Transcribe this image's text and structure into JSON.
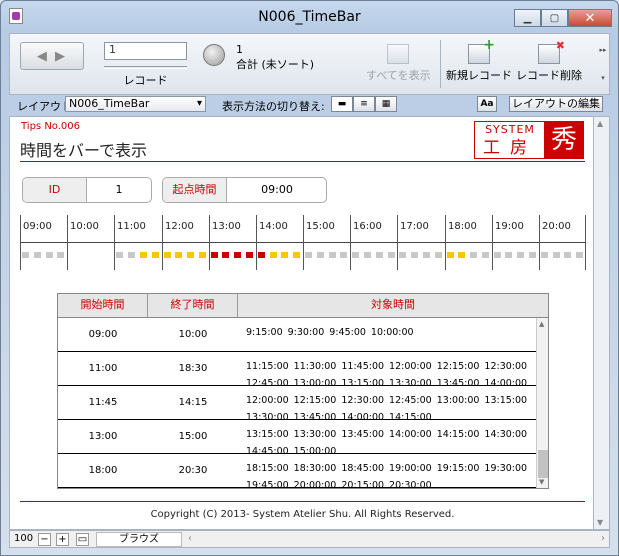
{
  "window": {
    "title": "N006_TimeBar"
  },
  "toolbar": {
    "record_value": "1",
    "record_label": "レコード",
    "found_count": "1",
    "found_label": "合計 (未ソート)",
    "show_all": "すべてを表示",
    "new_record": "新規レコード",
    "delete_record": "レコード削除"
  },
  "layoutbar": {
    "label": "レイアウト:",
    "layout": "N006_TimeBar",
    "view_as": "表示方法の切り替え:",
    "aa": "Aa",
    "edit_layout": "レイアウトの編集"
  },
  "page": {
    "tips": "Tips No.006",
    "heading": "時間をバーで表示",
    "logo": {
      "system": "SYSTEM",
      "kobo": "工房",
      "shu": "秀"
    },
    "id_label": "ID",
    "id_value": "1",
    "start_label": "起点時間",
    "start_value": "09:00"
  },
  "timeline": {
    "hours": [
      "09:00",
      "10:00",
      "11:00",
      "12:00",
      "13:00",
      "14:00",
      "15:00",
      "16:00",
      "17:00",
      "18:00",
      "19:00",
      "20:00"
    ],
    "segments_per_hour": 4,
    "slots": [
      "g",
      "g",
      "g",
      "g",
      "",
      "",
      "",
      "",
      "g",
      "g",
      "y",
      "y",
      "y",
      "y",
      "y",
      "y",
      "r",
      "r",
      "r",
      "r",
      "r",
      "y",
      "y",
      "y",
      "g",
      "g",
      "g",
      "g",
      "g",
      "g",
      "g",
      "g",
      "g",
      "g",
      "g",
      "g",
      "y",
      "y",
      "g",
      "g",
      "g",
      "g",
      "g",
      "g",
      "g",
      "g",
      "g",
      "g"
    ],
    "colors": {
      "g": "#c8c8c8",
      "y": "#f6c800",
      "r": "#c80000"
    }
  },
  "table": {
    "headers": [
      "開始時間",
      "終了時間",
      "対象時間"
    ],
    "rows": [
      {
        "start": "09:00",
        "end": "10:00",
        "times": "9:15:00 9:30:00 9:45:00 10:00:00"
      },
      {
        "start": "11:00",
        "end": "18:30",
        "times": "11:15:00 11:30:00 11:45:00 12:00:00 12:15:00 12:30:00 12:45:00 13:00:00 13:15:00 13:30:00 13:45:00 14:00:00"
      },
      {
        "start": "11:45",
        "end": "14:15",
        "times": "12:00:00 12:15:00 12:30:00 12:45:00 13:00:00 13:15:00 13:30:00 13:45:00 14:00:00 14:15:00"
      },
      {
        "start": "13:00",
        "end": "15:00",
        "times": "13:15:00 13:30:00 13:45:00 14:00:00 14:15:00 14:30:00 14:45:00 15:00:00"
      },
      {
        "start": "18:00",
        "end": "20:30",
        "times": "18:15:00 18:30:00 18:45:00 19:00:00 19:15:00 19:30:00 19:45:00 20:00:00 20:15:00 20:30:00"
      }
    ]
  },
  "footer": {
    "copyright": "Copyright (C) 2013- System Atelier Shu. All Rights Reserved."
  },
  "statusbar": {
    "zoom": "100",
    "mode": "ブラウズ"
  }
}
